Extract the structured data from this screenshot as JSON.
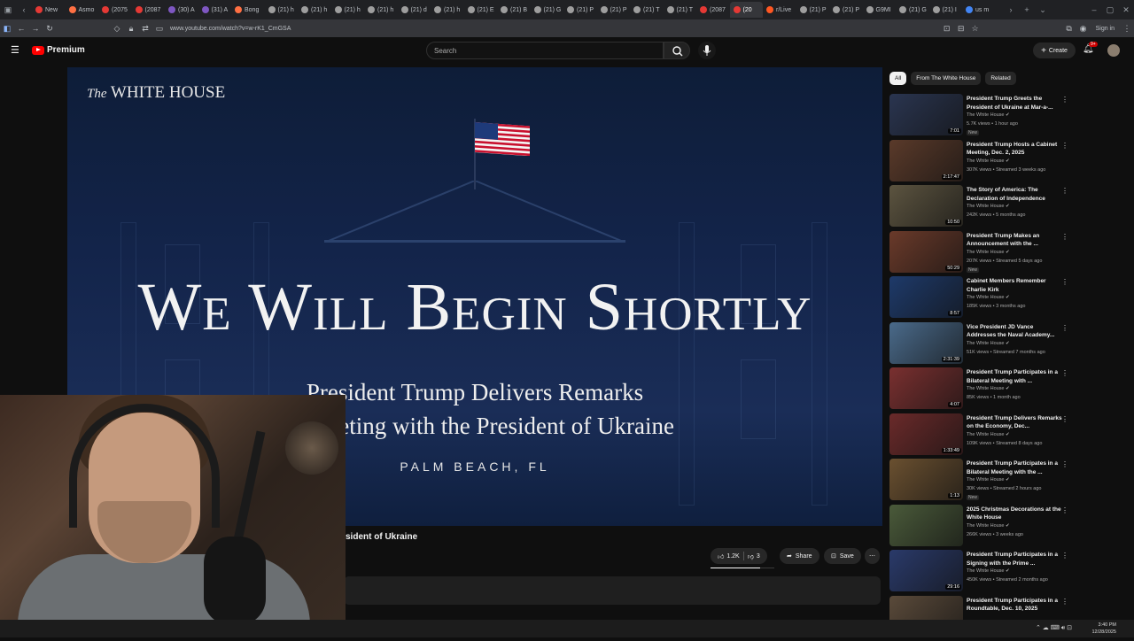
{
  "browser": {
    "tabs": [
      {
        "label": "New",
        "color": "#e53935"
      },
      {
        "label": "Asmo",
        "color": "#ff7043"
      },
      {
        "label": "(2075",
        "color": "#e53935"
      },
      {
        "label": "(2087",
        "color": "#e53935"
      },
      {
        "label": "(30) A",
        "color": "#7e57c2"
      },
      {
        "label": "(31) A",
        "color": "#7e57c2"
      },
      {
        "label": "Bong",
        "color": "#ff7043"
      },
      {
        "label": "(21) h",
        "color": "#9e9e9e"
      },
      {
        "label": "(21) h",
        "color": "#9e9e9e"
      },
      {
        "label": "(21) h",
        "color": "#9e9e9e"
      },
      {
        "label": "(21) h",
        "color": "#9e9e9e"
      },
      {
        "label": "(21) d",
        "color": "#9e9e9e"
      },
      {
        "label": "(21) h",
        "color": "#9e9e9e"
      },
      {
        "label": "(21) E",
        "color": "#9e9e9e"
      },
      {
        "label": "(21) B",
        "color": "#9e9e9e"
      },
      {
        "label": "(21) G",
        "color": "#9e9e9e"
      },
      {
        "label": "(21) P",
        "color": "#9e9e9e"
      },
      {
        "label": "(21) P",
        "color": "#9e9e9e"
      },
      {
        "label": "(21) T",
        "color": "#9e9e9e"
      },
      {
        "label": "(21) T",
        "color": "#9e9e9e"
      },
      {
        "label": "(2087",
        "color": "#e53935"
      },
      {
        "label": "(20",
        "color": "#e53935",
        "active": true
      },
      {
        "label": "r/Live",
        "color": "#ff5722"
      },
      {
        "label": "(21) P",
        "color": "#9e9e9e"
      },
      {
        "label": "(21) P",
        "color": "#9e9e9e"
      },
      {
        "label": "G9MI",
        "color": "#9e9e9e"
      },
      {
        "label": "(21) G",
        "color": "#9e9e9e"
      },
      {
        "label": "(21) I",
        "color": "#9e9e9e"
      },
      {
        "label": "us m",
        "color": "#4285f4"
      }
    ],
    "url": "www.youtube.com/watch?v=w-rK1_CmGSA",
    "signin": "Sign in"
  },
  "header": {
    "brand": "Premium",
    "search_placeholder": "Search",
    "create": "Create",
    "notif_count": "9+"
  },
  "player": {
    "logo_the": "The",
    "logo_name": "WHITE HOUSE",
    "headline": "We Will Begin Shortly",
    "sub1": "President Trump Delivers Remarks",
    "sub2": "ral Meeting with the President of Ukraine",
    "location": "PALM BEACH, FL"
  },
  "video": {
    "title_visible": "sident of Ukraine",
    "likes": "1.2K",
    "dislikes": "3",
    "share": "Share",
    "save": "Save"
  },
  "chips": [
    "All",
    "From The White House",
    "Related"
  ],
  "recommendations": [
    {
      "title": "President Trump Greets the President of Ukraine at Mar-a-...",
      "channel": "The White House",
      "meta": "5.7K views • 1 hour ago",
      "duration": "7:01",
      "new": "New",
      "thumb": "#2a3550"
    },
    {
      "title": "President Trump Hosts a Cabinet Meeting, Dec. 2, 2025",
      "channel": "The White House",
      "meta": "307K views • Streamed 3 weeks ago",
      "duration": "2:17:47",
      "new": "",
      "thumb": "#5a3a2a"
    },
    {
      "title": "The Story of America: The Declaration of Independence",
      "channel": "The White House",
      "meta": "242K views • 5 months ago",
      "duration": "10:50",
      "new": "",
      "thumb": "#5c5440"
    },
    {
      "title": "President Trump Makes an Announcement with the ...",
      "channel": "The White House",
      "meta": "207K views • Streamed 5 days ago",
      "duration": "50:29",
      "new": "New",
      "thumb": "#6a3a2a"
    },
    {
      "title": "Cabinet Members Remember Charlie Kirk",
      "channel": "The White House",
      "meta": "185K views • 3 months ago",
      "duration": "8:57",
      "new": "",
      "thumb": "#1e3a6a"
    },
    {
      "title": "Vice President JD Vance Addresses the Naval Academy...",
      "channel": "The White House",
      "meta": "51K views • Streamed 7 months ago",
      "duration": "2:31:39",
      "new": "",
      "thumb": "#4a6a8a"
    },
    {
      "title": "President Trump Participates in a Bilateral Meeting with ...",
      "channel": "The White House",
      "meta": "85K views • 1 month ago",
      "duration": "4:07",
      "new": "",
      "thumb": "#7a3030"
    },
    {
      "title": "President Trump Delivers Remarks on the Economy, Dec...",
      "channel": "The White House",
      "meta": "109K views • Streamed 8 days ago",
      "duration": "1:33:49",
      "new": "",
      "thumb": "#6a2a2a"
    },
    {
      "title": "President Trump Participates in a Bilateral Meeting with the ...",
      "channel": "The White House",
      "meta": "30K views • Streamed 2 hours ago",
      "duration": "1:13",
      "new": "New",
      "thumb": "#6a5030"
    },
    {
      "title": "2025 Christmas Decorations at the White House",
      "channel": "The White House",
      "meta": "266K views • 3 weeks ago",
      "duration": "",
      "new": "",
      "thumb": "#4a5a3a"
    },
    {
      "title": "President Trump Participates in a Signing with the Prime ...",
      "channel": "The White House",
      "meta": "450K views • Streamed 2 months ago",
      "duration": "29:16",
      "new": "",
      "thumb": "#2a3a6a"
    },
    {
      "title": "President Trump Participates in a Roundtable, Dec. 10, 2025",
      "channel": "",
      "meta": "",
      "duration": "",
      "new": "",
      "thumb": "#5a4a3a"
    }
  ],
  "taskbar": {
    "time": "3:40 PM",
    "date": "12/28/2025"
  }
}
